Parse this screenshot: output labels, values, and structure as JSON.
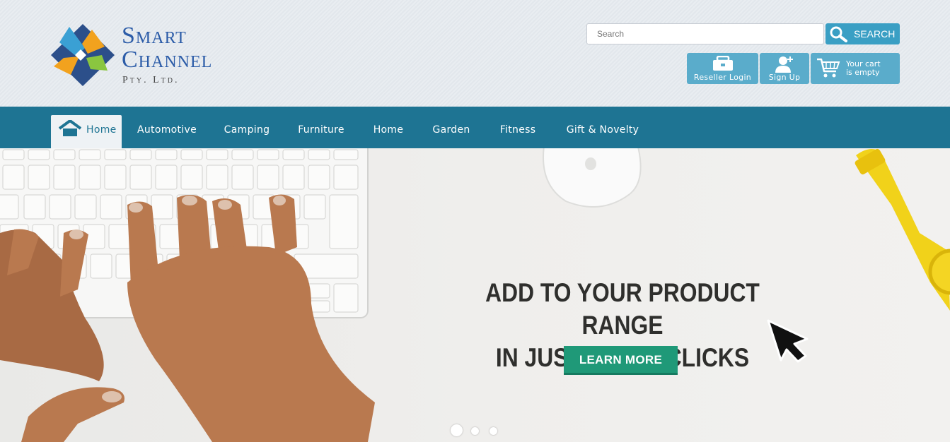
{
  "header": {
    "logo": {
      "word1": "Smart",
      "word2": "Channel",
      "sub": "Pty. Ltd.",
      "colors": [
        "#2c4f8a",
        "#f2a21e",
        "#8ac63f",
        "#3aa0d4"
      ]
    },
    "search": {
      "placeholder": "Search",
      "button_label": "SEARCH",
      "button_icon": "magnifier-icon"
    },
    "account": {
      "reseller_label": "Reseller Login",
      "reseller_icon": "briefcase-icon",
      "signup_label": "Sign Up",
      "signup_icon": "add-user-icon",
      "cart_line1": "Your cart",
      "cart_line2": "is empty",
      "cart_icon": "shopping-cart-icon"
    }
  },
  "nav": {
    "home_icon": "house-icon",
    "items": [
      {
        "label": "Home"
      },
      {
        "label": "Automotive"
      },
      {
        "label": "Camping"
      },
      {
        "label": "Furniture"
      },
      {
        "label": "Home"
      },
      {
        "label": "Garden"
      },
      {
        "label": "Fitness"
      },
      {
        "label": "Gift & Novelty"
      }
    ],
    "active_index": 0,
    "color": "#1e7493"
  },
  "hero": {
    "headline_line1": "ADD TO YOUR PRODUCT RANGE",
    "headline_line2": "IN JUST A FEW CLICKS",
    "cta_label": "LEARN MORE",
    "cta_color": "#1f9978",
    "slide_count": 3,
    "active_slide": 1
  }
}
